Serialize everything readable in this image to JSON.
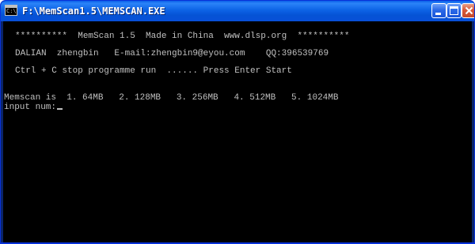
{
  "window": {
    "title": "F:\\MemScan1.5\\MEMSCAN.EXE",
    "icon": "console-app-icon",
    "icon_glyph": "C:\\",
    "controls": {
      "minimize": "minimize-icon",
      "maximize": "maximize-icon",
      "close": "close-icon"
    },
    "accent_color": "#0a5ee8",
    "close_color": "#d9593a"
  },
  "console": {
    "background": "#000000",
    "foreground": "#c0c0c0",
    "lines": [
      "**********  MemScan 1.5  Made in China  www.dlsp.org  **********",
      "DALIAN  zhengbin   E-mail:zhengbin9@eyou.com    QQ:396539769",
      "Ctrl + C stop programme run  ...... Press Enter Start",
      "Memscan is  1. 64MB   2. 128MB   3. 256MB   4. 512MB   5. 1024MB",
      "input num:"
    ]
  }
}
